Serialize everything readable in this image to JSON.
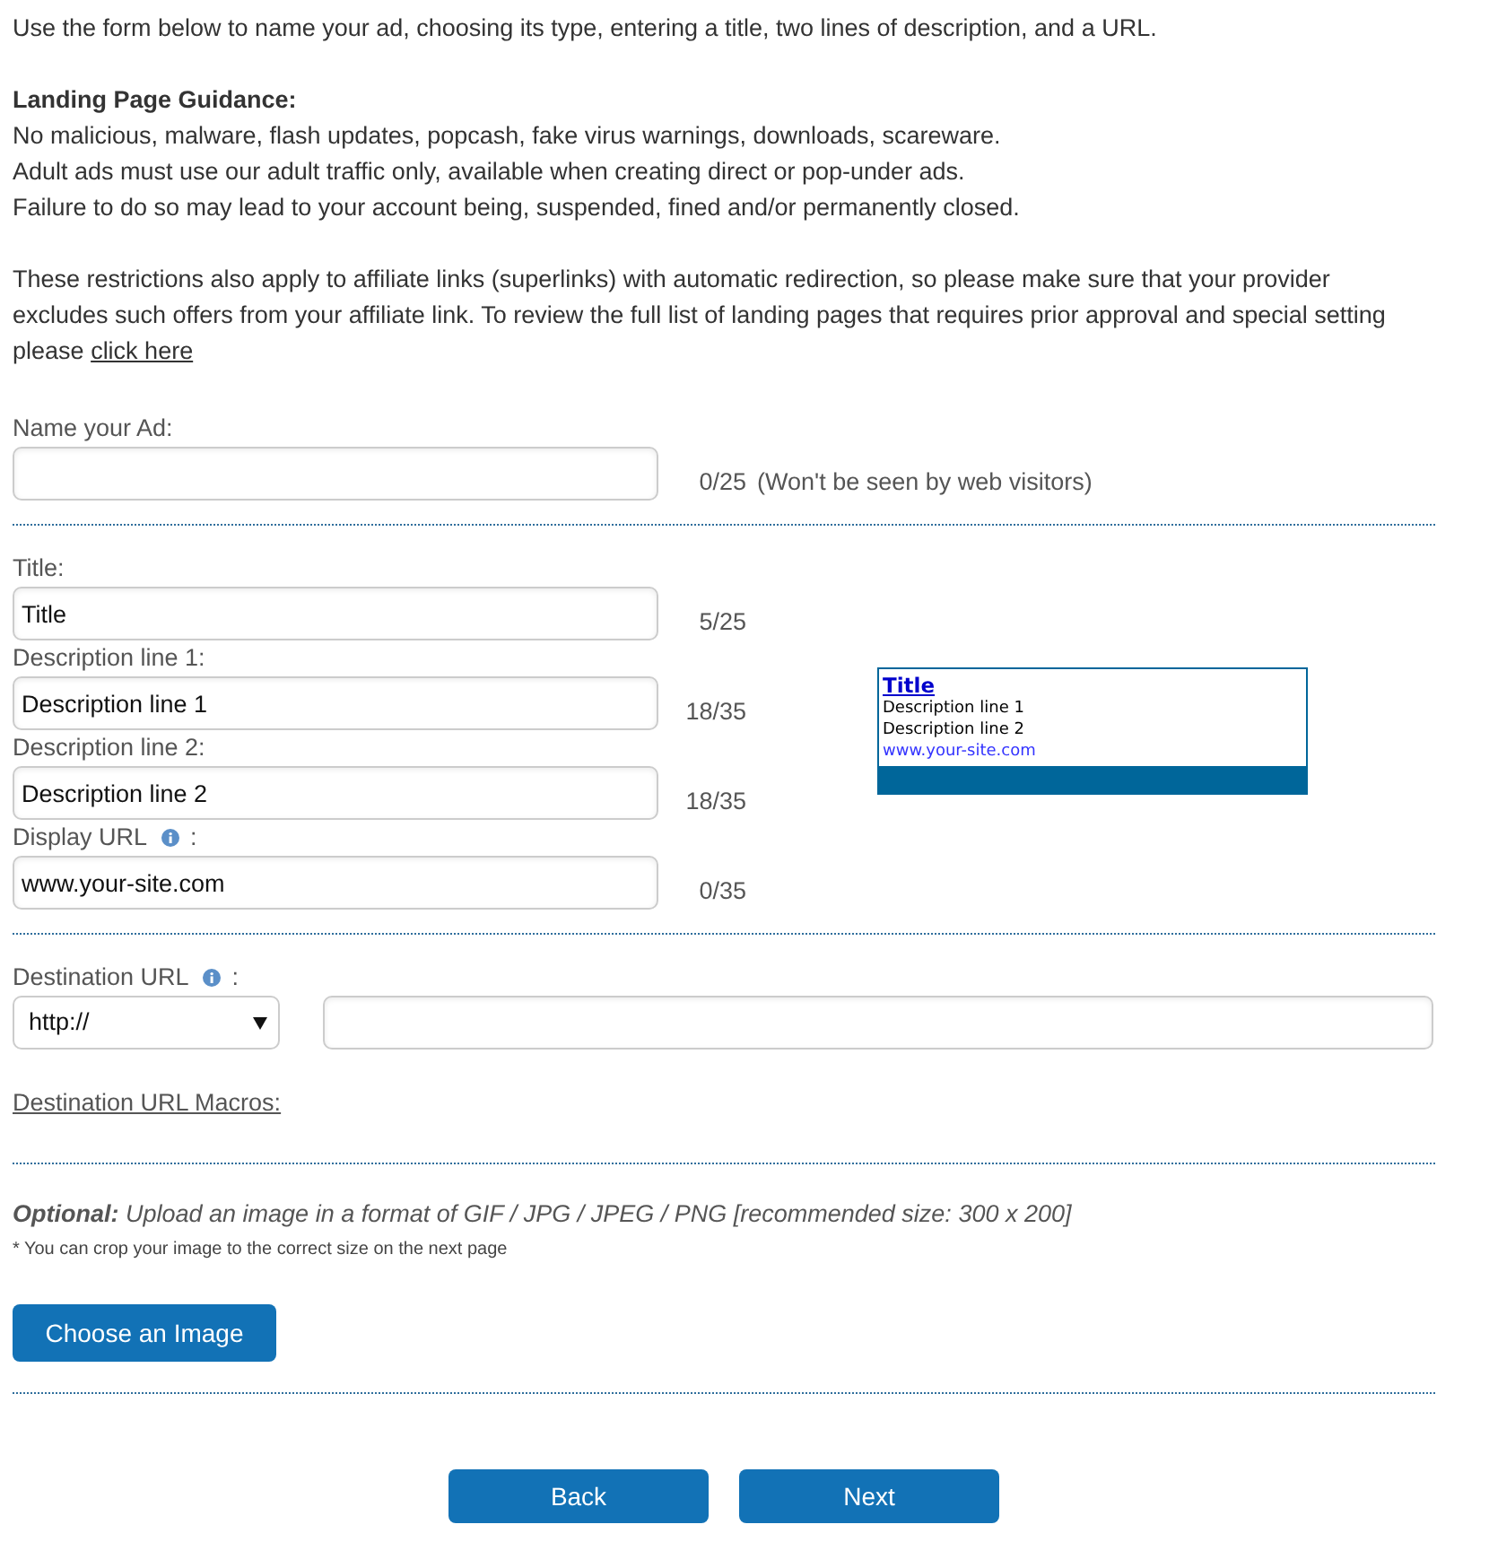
{
  "intro": "Use the form below to name your ad, choosing its type, entering a title, two lines of description, and a URL.",
  "guidance": {
    "heading": "Landing Page Guidance:",
    "lines": [
      "No malicious, malware, flash updates, popcash, fake virus warnings, downloads, scareware.",
      "Adult ads must use our adult traffic only, available when creating direct or pop-under ads.",
      "Failure to do so may lead to your account being, suspended, fined and/or permanently closed."
    ]
  },
  "restrictions": {
    "text": "These restrictions also apply to affiliate links (superlinks) with automatic redirection, so please make sure that your provider excludes such offers from your affiliate link. To review the full list of landing pages that requires prior approval and special setting please",
    "link": "click here"
  },
  "name_ad": {
    "label": "Name your Ad:",
    "counter": "0/25",
    "note": "(Won't be seen by web visitors)"
  },
  "ad_fields": [
    {
      "label": "Title:",
      "info": false,
      "value": "Title",
      "counter": "5/25"
    },
    {
      "label": "Description line 1:",
      "info": false,
      "value": "Description line 1",
      "counter": "18/35"
    },
    {
      "label": "Description line 2:",
      "info": false,
      "value": "Description line 2",
      "counter": "18/35"
    },
    {
      "label": "Display URL",
      "info": true,
      "label_end": ":",
      "value": "www.your-site.com",
      "counter": "0/35"
    }
  ],
  "preview": {
    "title": "Title",
    "lines": [
      "Description line 1",
      "Description line 2"
    ],
    "url": "www.your-site.com"
  },
  "destination": {
    "label": "Destination URL",
    "info": true,
    "label_end": ":",
    "protocol": "http://"
  },
  "macros_link": "Destination URL Macros:",
  "upload": {
    "text": "**Optional:** Upload an image in a format of GIF / JPG / JPEG / PNG [recommended size: 300 x 200]",
    "note": "* You can crop your image to the correct size on the next page",
    "button": "Choose an Image"
  },
  "nav_buttons": [
    "Back",
    "Next"
  ]
}
